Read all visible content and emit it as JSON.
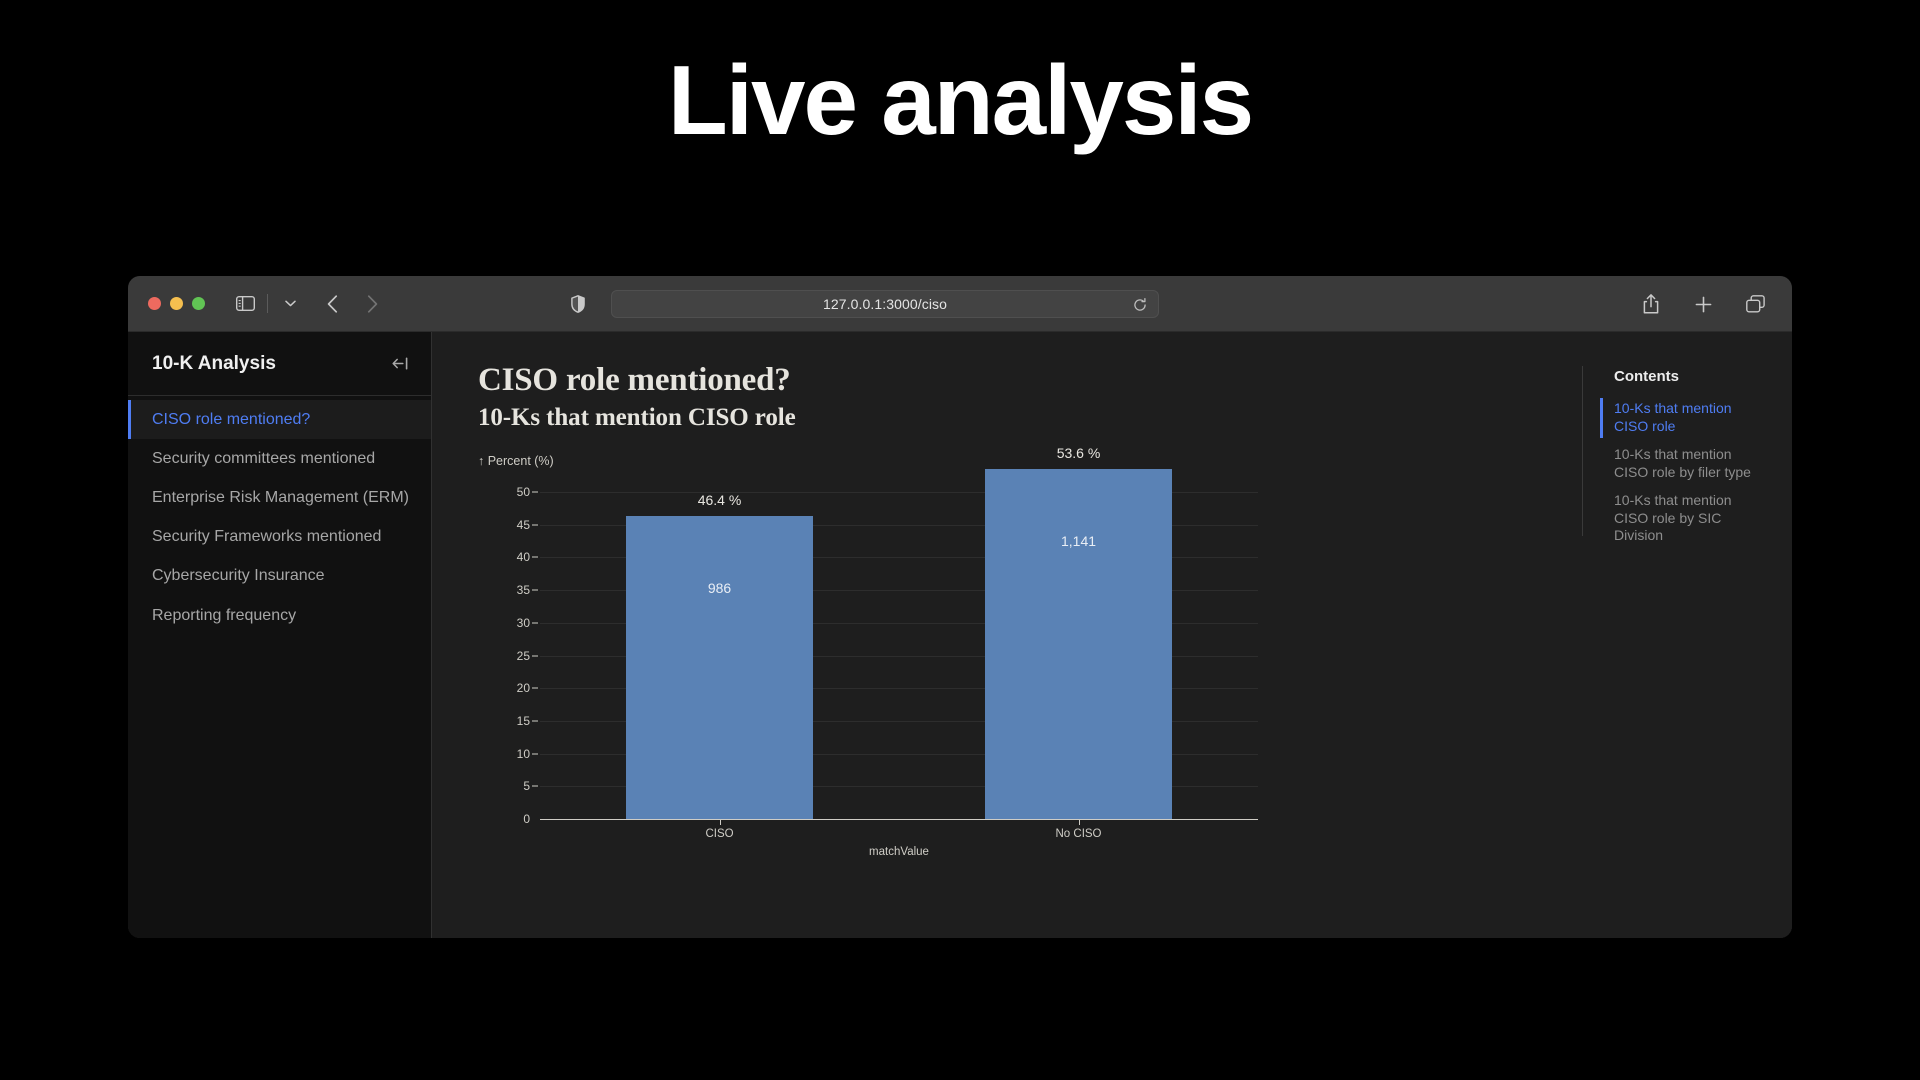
{
  "slide": {
    "title": "Live analysis"
  },
  "browser": {
    "url": "127.0.0.1:3000/ciso",
    "icons": {
      "sidebar_toggle": "sidebar-toggle-icon",
      "chevron_down": "chevron-down-icon",
      "back": "back-arrow-icon",
      "forward": "forward-arrow-icon",
      "shield": "shield-icon",
      "reload": "reload-icon",
      "share": "share-icon",
      "new_tab": "plus-icon",
      "tab_overview": "tab-overview-icon"
    },
    "window_controls": [
      "close",
      "minimize",
      "zoom"
    ]
  },
  "sidebar": {
    "title": "10-K Analysis",
    "collapse_icon": "collapse-sidebar-icon",
    "items": [
      {
        "label": "CISO role mentioned?",
        "active": true
      },
      {
        "label": "Security committees mentioned",
        "active": false
      },
      {
        "label": "Enterprise Risk Management (ERM)",
        "active": false
      },
      {
        "label": "Security Frameworks mentioned",
        "active": false
      },
      {
        "label": "Cybersecurity Insurance",
        "active": false
      },
      {
        "label": "Reporting frequency",
        "active": false
      }
    ]
  },
  "main": {
    "title": "CISO role mentioned?",
    "subtitle": "10-Ks that mention CISO role"
  },
  "toc": {
    "title": "Contents",
    "items": [
      {
        "label": "10-Ks that mention CISO role",
        "active": true
      },
      {
        "label": "10-Ks that mention CISO role by filer type",
        "active": false
      },
      {
        "label": "10-Ks that mention CISO role by SIC Division",
        "active": false
      }
    ]
  },
  "chart_data": {
    "type": "bar",
    "title": "CISO role mentioned?",
    "subtitle": "10-Ks that mention CISO role",
    "categories": [
      "CISO",
      "No CISO"
    ],
    "values": [
      46.4,
      53.6
    ],
    "counts": [
      "986",
      "1,141"
    ],
    "value_labels": [
      "46.4 %",
      "53.6 %"
    ],
    "xlabel": "matchValue",
    "ylabel": "↑ Percent (%)",
    "ylim": [
      0,
      52
    ],
    "yticks": [
      0,
      5,
      10,
      15,
      20,
      25,
      30,
      35,
      40,
      45,
      50
    ],
    "ytick_labels": [
      "0",
      "5",
      "10",
      "15",
      "20",
      "25",
      "30",
      "35",
      "40",
      "45",
      "50"
    ],
    "grid": true,
    "legend": "none",
    "bar_color": "#5a82b5"
  },
  "colors": {
    "page_background": "#000000",
    "browser_chrome": "#3a3a3a",
    "content_background": "#1e1e1e",
    "sidebar_background": "#111111",
    "accent_blue": "#4f7df3",
    "bar_blue": "#5a82b5",
    "serif_text": "#e6e4de"
  }
}
